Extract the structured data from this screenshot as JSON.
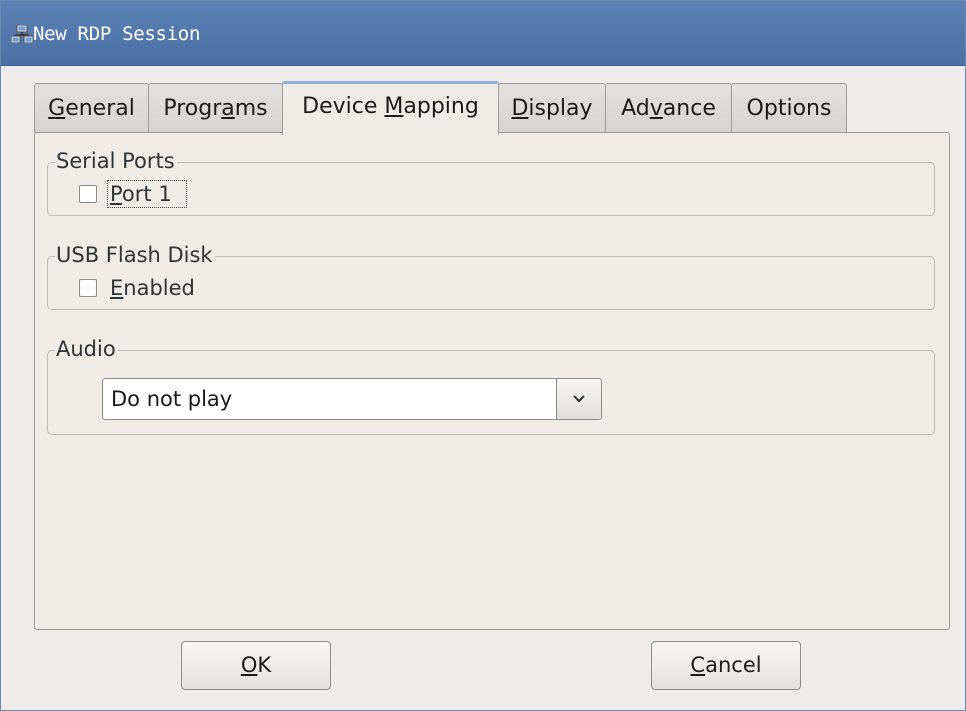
{
  "window": {
    "title": "New RDP Session",
    "icon": "network-computers-icon"
  },
  "tabs": [
    {
      "pre": "",
      "mn": "G",
      "post": "eneral",
      "active": false
    },
    {
      "pre": "Progr",
      "mn": "a",
      "post": "ms",
      "active": false
    },
    {
      "pre": "Device ",
      "mn": "M",
      "post": "apping",
      "active": true
    },
    {
      "pre": "",
      "mn": "D",
      "post": "isplay",
      "active": false
    },
    {
      "pre": "Ad",
      "mn": "v",
      "post": "ance",
      "active": false
    },
    {
      "pre": "Options",
      "mn": "",
      "post": "",
      "active": false
    }
  ],
  "serial_ports": {
    "title": "Serial Ports",
    "port1": {
      "mn": "P",
      "rest": "ort 1",
      "checked": false
    }
  },
  "usb_flash_disk": {
    "title": "USB Flash Disk",
    "enabled": {
      "mn": "E",
      "rest": "nabled",
      "checked": false
    }
  },
  "audio": {
    "title": "Audio",
    "selected": "Do not play"
  },
  "buttons": {
    "ok": {
      "mn": "O",
      "rest": "K"
    },
    "cancel": {
      "mn": "C",
      "rest": "ancel"
    }
  },
  "colors": {
    "titlebar": "#5c82b5",
    "window_bg": "#edeceb",
    "panel_bg": "#efebe7",
    "tab_highlight": "#8fb0d8"
  }
}
